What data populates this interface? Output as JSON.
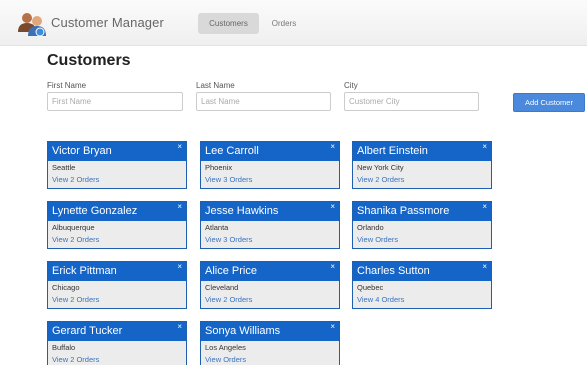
{
  "app": {
    "brand": "Customer Manager",
    "nav": {
      "customers": "Customers",
      "orders": "Orders"
    }
  },
  "page": {
    "title": "Customers"
  },
  "filters": {
    "first_name": {
      "label": "First Name",
      "placeholder": "First Name",
      "value": ""
    },
    "last_name": {
      "label": "Last Name",
      "placeholder": "Last Name",
      "value": ""
    },
    "city": {
      "label": "City",
      "placeholder": "Customer City",
      "value": ""
    }
  },
  "add_button": "Add Customer",
  "close_glyph": "×",
  "customers": [
    {
      "name": "Victor Bryan",
      "city": "Seattle",
      "orders": "View 2 Orders"
    },
    {
      "name": "Lee Carroll",
      "city": "Phoenix",
      "orders": "View 3 Orders"
    },
    {
      "name": "Albert Einstein",
      "city": "New York City",
      "orders": "View 2 Orders"
    },
    {
      "name": "Lynette Gonzalez",
      "city": "Albuquerque",
      "orders": "View 2 Orders"
    },
    {
      "name": "Jesse Hawkins",
      "city": "Atlanta",
      "orders": "View 3 Orders"
    },
    {
      "name": "Shanika Passmore",
      "city": "Orlando",
      "orders": "View Orders"
    },
    {
      "name": "Erick Pittman",
      "city": "Chicago",
      "orders": "View 2 Orders"
    },
    {
      "name": "Alice Price",
      "city": "Cleveland",
      "orders": "View 2 Orders"
    },
    {
      "name": "Charles Sutton",
      "city": "Quebec",
      "orders": "View 4 Orders"
    },
    {
      "name": "Gerard Tucker",
      "city": "Buffalo",
      "orders": "View 2 Orders"
    },
    {
      "name": "Sonya Williams",
      "city": "Los Angeles",
      "orders": "View Orders"
    }
  ],
  "colors": {
    "card_header": "#1565c9",
    "button": "#4a89dc",
    "link": "#3a74c0"
  }
}
